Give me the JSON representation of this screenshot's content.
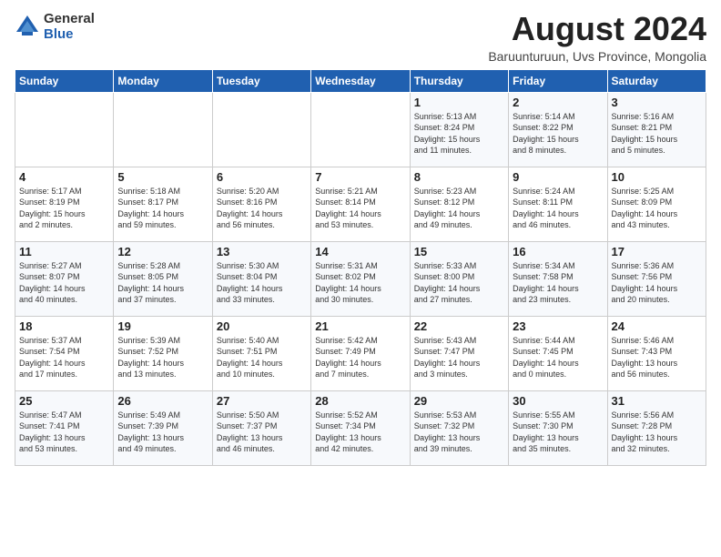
{
  "header": {
    "logo": {
      "line1": "General",
      "line2": "Blue"
    },
    "title": "August 2024",
    "subtitle": "Baruunturuun, Uvs Province, Mongolia"
  },
  "days_of_week": [
    "Sunday",
    "Monday",
    "Tuesday",
    "Wednesday",
    "Thursday",
    "Friday",
    "Saturday"
  ],
  "weeks": [
    [
      {
        "day": "",
        "info": ""
      },
      {
        "day": "",
        "info": ""
      },
      {
        "day": "",
        "info": ""
      },
      {
        "day": "",
        "info": ""
      },
      {
        "day": "1",
        "info": "Sunrise: 5:13 AM\nSunset: 8:24 PM\nDaylight: 15 hours\nand 11 minutes."
      },
      {
        "day": "2",
        "info": "Sunrise: 5:14 AM\nSunset: 8:22 PM\nDaylight: 15 hours\nand 8 minutes."
      },
      {
        "day": "3",
        "info": "Sunrise: 5:16 AM\nSunset: 8:21 PM\nDaylight: 15 hours\nand 5 minutes."
      }
    ],
    [
      {
        "day": "4",
        "info": "Sunrise: 5:17 AM\nSunset: 8:19 PM\nDaylight: 15 hours\nand 2 minutes."
      },
      {
        "day": "5",
        "info": "Sunrise: 5:18 AM\nSunset: 8:17 PM\nDaylight: 14 hours\nand 59 minutes."
      },
      {
        "day": "6",
        "info": "Sunrise: 5:20 AM\nSunset: 8:16 PM\nDaylight: 14 hours\nand 56 minutes."
      },
      {
        "day": "7",
        "info": "Sunrise: 5:21 AM\nSunset: 8:14 PM\nDaylight: 14 hours\nand 53 minutes."
      },
      {
        "day": "8",
        "info": "Sunrise: 5:23 AM\nSunset: 8:12 PM\nDaylight: 14 hours\nand 49 minutes."
      },
      {
        "day": "9",
        "info": "Sunrise: 5:24 AM\nSunset: 8:11 PM\nDaylight: 14 hours\nand 46 minutes."
      },
      {
        "day": "10",
        "info": "Sunrise: 5:25 AM\nSunset: 8:09 PM\nDaylight: 14 hours\nand 43 minutes."
      }
    ],
    [
      {
        "day": "11",
        "info": "Sunrise: 5:27 AM\nSunset: 8:07 PM\nDaylight: 14 hours\nand 40 minutes."
      },
      {
        "day": "12",
        "info": "Sunrise: 5:28 AM\nSunset: 8:05 PM\nDaylight: 14 hours\nand 37 minutes."
      },
      {
        "day": "13",
        "info": "Sunrise: 5:30 AM\nSunset: 8:04 PM\nDaylight: 14 hours\nand 33 minutes."
      },
      {
        "day": "14",
        "info": "Sunrise: 5:31 AM\nSunset: 8:02 PM\nDaylight: 14 hours\nand 30 minutes."
      },
      {
        "day": "15",
        "info": "Sunrise: 5:33 AM\nSunset: 8:00 PM\nDaylight: 14 hours\nand 27 minutes."
      },
      {
        "day": "16",
        "info": "Sunrise: 5:34 AM\nSunset: 7:58 PM\nDaylight: 14 hours\nand 23 minutes."
      },
      {
        "day": "17",
        "info": "Sunrise: 5:36 AM\nSunset: 7:56 PM\nDaylight: 14 hours\nand 20 minutes."
      }
    ],
    [
      {
        "day": "18",
        "info": "Sunrise: 5:37 AM\nSunset: 7:54 PM\nDaylight: 14 hours\nand 17 minutes."
      },
      {
        "day": "19",
        "info": "Sunrise: 5:39 AM\nSunset: 7:52 PM\nDaylight: 14 hours\nand 13 minutes."
      },
      {
        "day": "20",
        "info": "Sunrise: 5:40 AM\nSunset: 7:51 PM\nDaylight: 14 hours\nand 10 minutes."
      },
      {
        "day": "21",
        "info": "Sunrise: 5:42 AM\nSunset: 7:49 PM\nDaylight: 14 hours\nand 7 minutes."
      },
      {
        "day": "22",
        "info": "Sunrise: 5:43 AM\nSunset: 7:47 PM\nDaylight: 14 hours\nand 3 minutes."
      },
      {
        "day": "23",
        "info": "Sunrise: 5:44 AM\nSunset: 7:45 PM\nDaylight: 14 hours\nand 0 minutes."
      },
      {
        "day": "24",
        "info": "Sunrise: 5:46 AM\nSunset: 7:43 PM\nDaylight: 13 hours\nand 56 minutes."
      }
    ],
    [
      {
        "day": "25",
        "info": "Sunrise: 5:47 AM\nSunset: 7:41 PM\nDaylight: 13 hours\nand 53 minutes."
      },
      {
        "day": "26",
        "info": "Sunrise: 5:49 AM\nSunset: 7:39 PM\nDaylight: 13 hours\nand 49 minutes."
      },
      {
        "day": "27",
        "info": "Sunrise: 5:50 AM\nSunset: 7:37 PM\nDaylight: 13 hours\nand 46 minutes."
      },
      {
        "day": "28",
        "info": "Sunrise: 5:52 AM\nSunset: 7:34 PM\nDaylight: 13 hours\nand 42 minutes."
      },
      {
        "day": "29",
        "info": "Sunrise: 5:53 AM\nSunset: 7:32 PM\nDaylight: 13 hours\nand 39 minutes."
      },
      {
        "day": "30",
        "info": "Sunrise: 5:55 AM\nSunset: 7:30 PM\nDaylight: 13 hours\nand 35 minutes."
      },
      {
        "day": "31",
        "info": "Sunrise: 5:56 AM\nSunset: 7:28 PM\nDaylight: 13 hours\nand 32 minutes."
      }
    ]
  ]
}
